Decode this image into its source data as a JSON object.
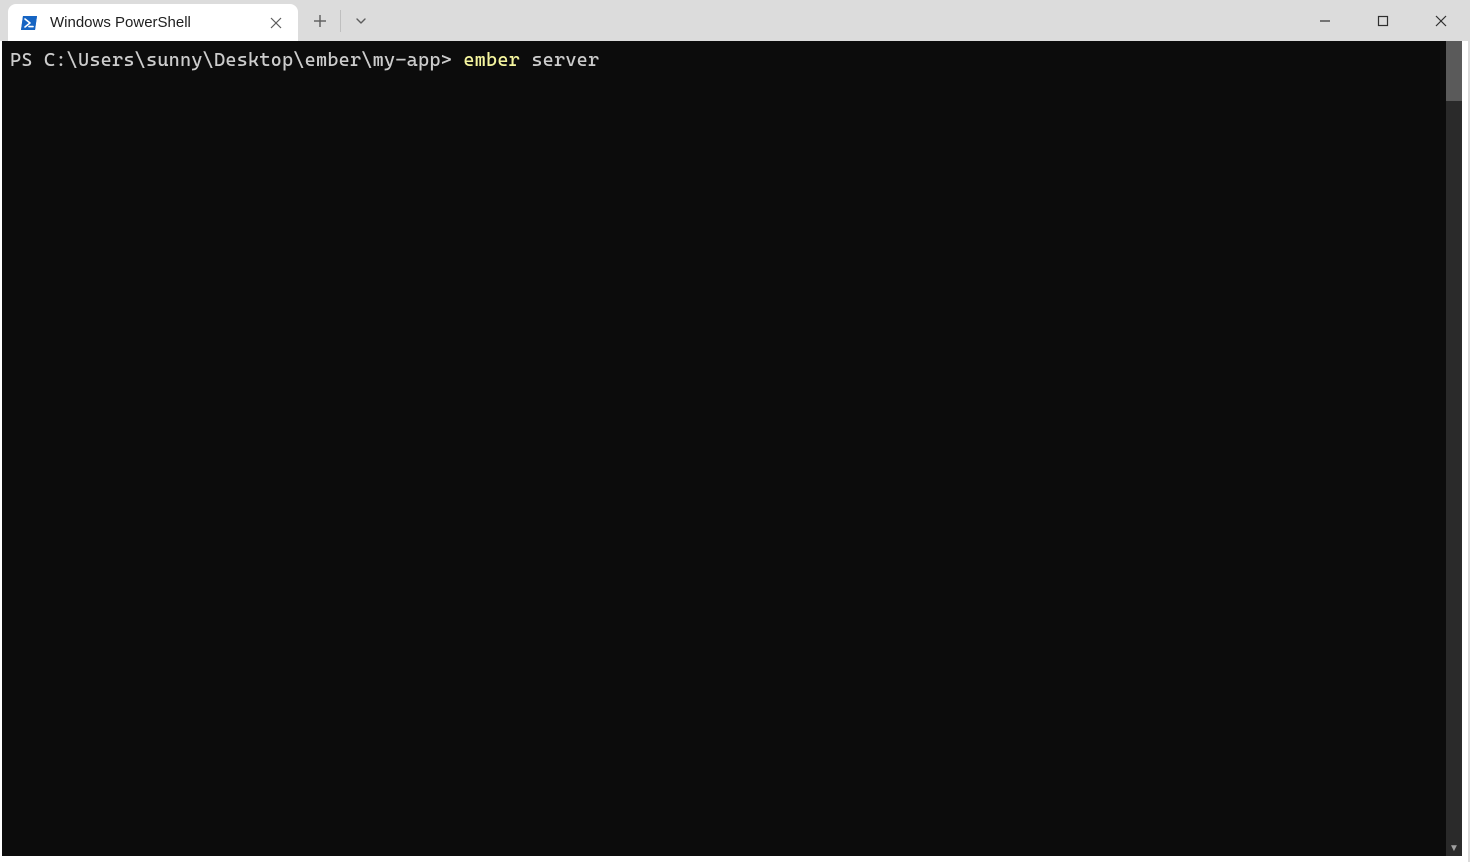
{
  "window": {
    "minimize_tooltip": "Minimize",
    "maximize_tooltip": "Maximize",
    "close_tooltip": "Close"
  },
  "tabs": {
    "active": {
      "title": "Windows PowerShell",
      "icon": "powershell-icon"
    },
    "new_tab_tooltip": "New Tab",
    "profiles_tooltip": "Open a new tab"
  },
  "terminal": {
    "prompt_prefix": "PS ",
    "cwd": "C:\\Users\\sunny\\Desktop\\ember\\my-app",
    "prompt_symbol": "> ",
    "command_name": "ember",
    "command_arg": " server"
  }
}
